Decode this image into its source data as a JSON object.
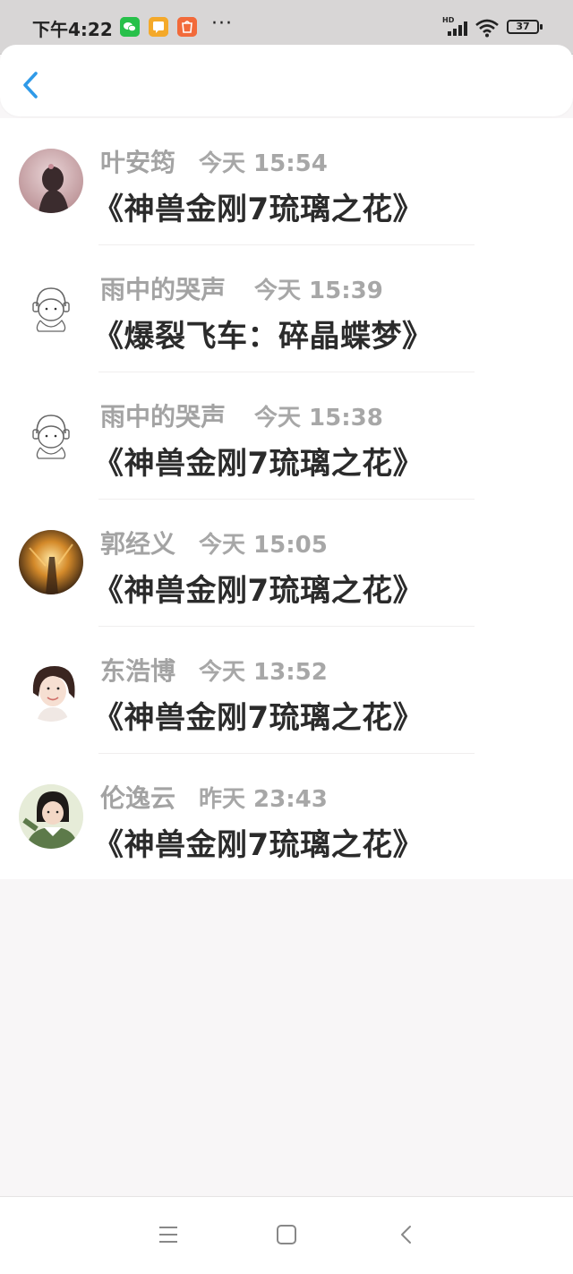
{
  "status_bar": {
    "time": "下午4:22",
    "app_icons": [
      {
        "name": "wechat-icon",
        "label": "",
        "color": "#27c04a"
      },
      {
        "name": "notes-icon",
        "label": "",
        "color": "#f4a92a"
      },
      {
        "name": "mi-store-icon",
        "label": "mi",
        "color": "#f26a3a"
      }
    ],
    "more": "···",
    "hd_label": "HD",
    "battery": "37"
  },
  "header": {
    "back_icon": "chevron-left-icon",
    "accent_color": "#2f9ae8"
  },
  "comments": [
    {
      "user": "叶安筠",
      "time": "今天 15:54",
      "title": "《神兽金刚7琉璃之花》"
    },
    {
      "user": "雨中的哭声",
      "time": "今天 15:39",
      "title": "《爆裂飞车：碎晶蝶梦》"
    },
    {
      "user": "雨中的哭声",
      "time": "今天 15:38",
      "title": "《神兽金刚7琉璃之花》"
    },
    {
      "user": "郭经义",
      "time": "今天 15:05",
      "title": "《神兽金刚7琉璃之花》"
    },
    {
      "user": "东浩博",
      "time": "今天 13:52",
      "title": "《神兽金刚7琉璃之花》"
    },
    {
      "user": "伦逸云",
      "time": "昨天 23:43",
      "title": "《神兽金刚7琉璃之花》"
    }
  ],
  "nav_bar": {
    "icons": [
      "menu-icon",
      "home-icon",
      "back-icon"
    ]
  }
}
